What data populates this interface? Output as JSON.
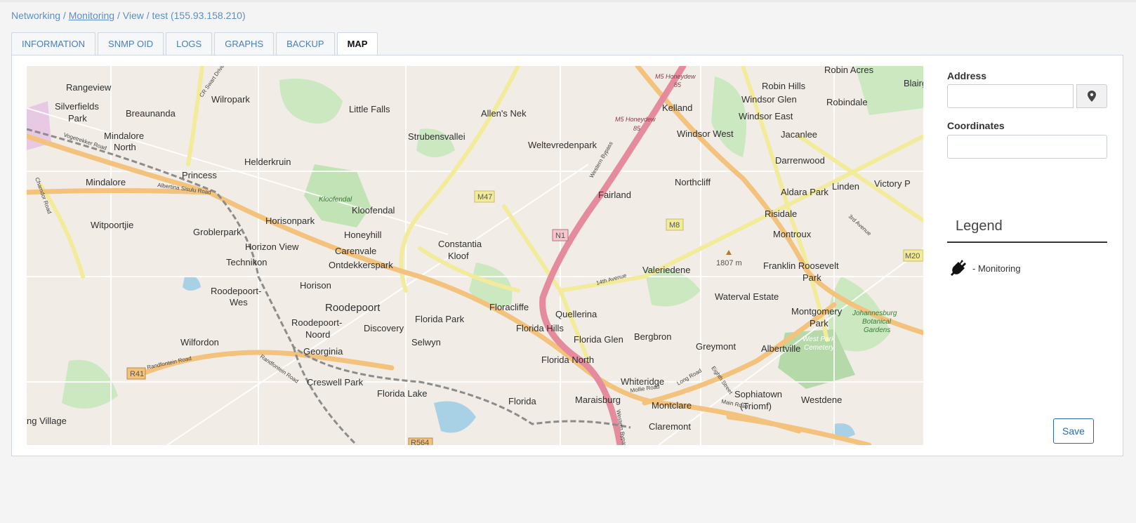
{
  "breadcrumb": {
    "networking": "Networking",
    "sep1": " / ",
    "monitoring": "Monitoring",
    "sep2": " / ",
    "view": "View",
    "sep3": " / ",
    "current": "test (155.93.158.210)"
  },
  "tabs": [
    {
      "label": "INFORMATION"
    },
    {
      "label": "SNMP OID"
    },
    {
      "label": "LOGS"
    },
    {
      "label": "GRAPHS"
    },
    {
      "label": "BACKUP"
    },
    {
      "label": "MAP",
      "active": true
    }
  ],
  "form": {
    "address_label": "Address",
    "address_value": "",
    "coordinates_label": "Coordinates",
    "coordinates_value": ""
  },
  "legend": {
    "title": "Legend",
    "items": [
      {
        "icon": "plug-icon",
        "label": "- Monitoring"
      }
    ]
  },
  "save_label": "Save",
  "map": {
    "places": [
      "Rangeview",
      "Wilropark",
      "Silverfields Park",
      "Breaunanda",
      "Mindalore North",
      "Little Falls",
      "Allen's Nek",
      "Strubensvallei",
      "Weltevredenpark",
      "Kelland",
      "Windsor Glen",
      "Robin Hills",
      "Robin Acres",
      "Blairg",
      "Robindale",
      "Windsor East",
      "Windsor West",
      "Jacanlee",
      "Darrenwood",
      "Helderkruin",
      "Princess",
      "Mindalore",
      "Kloofendal",
      "Fairland",
      "Northcliff",
      "Aldara Park",
      "Linden",
      "Victory P",
      "Witpoortjie",
      "Groblerpark",
      "Horisonpark",
      "Honeyhill",
      "Constantia Kloof",
      "Risidale",
      "Montroux",
      "Horizon View",
      "Carenvale",
      "Technikon",
      "Ontdekkerspark",
      "Valeriedene",
      "Franklin Roosevelt Park",
      "Roodepoort-Wes",
      "Horison",
      "Roodepoort",
      "Florida Park",
      "Floracliffe",
      "Quellerina",
      "Waterval Estate",
      "Montgomery Park",
      "Roodepoort-Noord",
      "Discovery",
      "Florida Hills",
      "Florida Glen",
      "Bergbron",
      "Wilfordon",
      "Selwyn",
      "Georginia",
      "Greymont",
      "Albertville",
      "Florida North",
      "Whiteridge",
      "Creswell Park",
      "Florida Lake",
      "Florida",
      "Maraisburg",
      "Sophiatown (Triomf)",
      "Westdene",
      "Montclare",
      "Claremont",
      "ng Village"
    ],
    "road_labels": [
      "M5 Honeydew 85",
      "M5 Honeydew 85",
      "Vogetrekker Road",
      "Albertina Sisulu Road",
      "Chamdor Road",
      "CR Swart Drive",
      "Western Bypass",
      "14th Avenue",
      "Randfontein Road",
      "Mollie Road",
      "Long Road",
      "Main Road",
      "Eighth Street",
      "3rd Avenue",
      "Western Bypass"
    ],
    "shields": [
      "M47",
      "N1",
      "M8",
      "R41",
      "M20",
      "R564"
    ],
    "green_labels": [
      "Kloofendal",
      "Johannesburg Botanical Gardens",
      "West Park Cemetery"
    ],
    "elevation": "1807 m"
  },
  "colors": {
    "link": "#5b8fc7",
    "accent": "#2c6aa8",
    "motorway": "#e58b9e",
    "primary_road": "#f6c98c",
    "secondary_road": "#f6f3a8",
    "park": "#c8e9bf",
    "water": "#a9d1e6"
  }
}
